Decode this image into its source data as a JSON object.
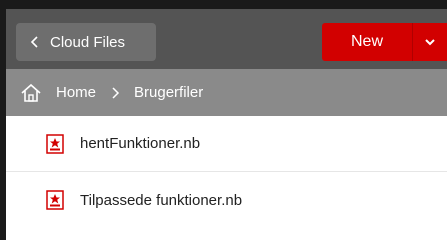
{
  "topbar": {
    "back_label": "Cloud Files",
    "new_label": "New"
  },
  "breadcrumb": {
    "home_label": "Home",
    "current_label": "Brugerfiler"
  },
  "files": [
    {
      "name": "hentFunktioner.nb",
      "icon": "notebook-icon"
    },
    {
      "name": "Tilpassede funktioner.nb",
      "icon": "notebook-icon"
    }
  ],
  "colors": {
    "topbar_bg": "#545454",
    "breadcrumb_bg": "#8a8a8a",
    "accent": "#d20000"
  }
}
